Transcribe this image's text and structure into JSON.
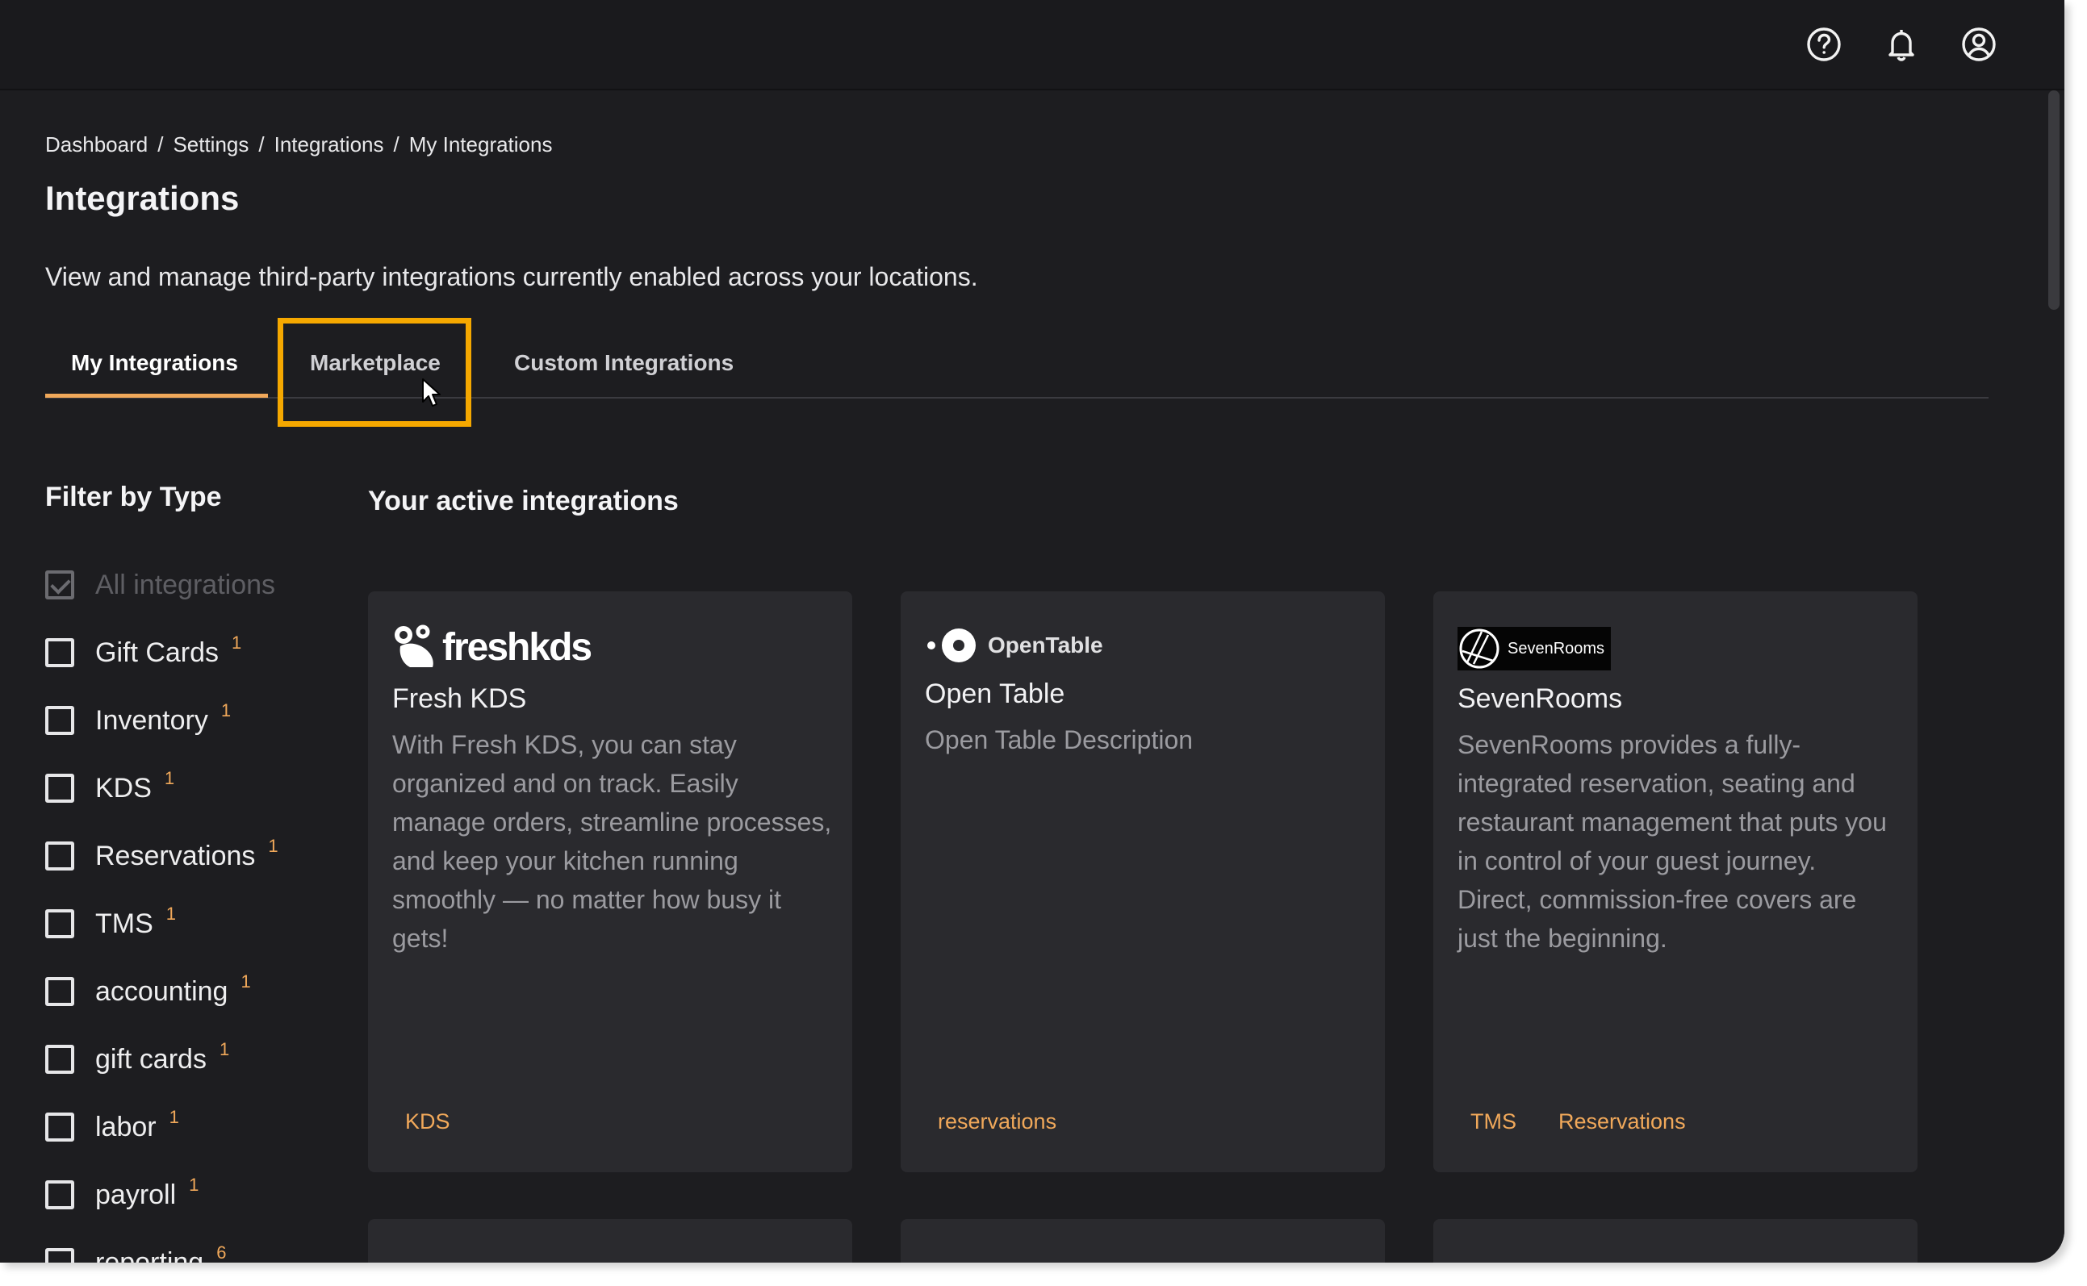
{
  "header": {
    "icons": [
      "help-circle-icon",
      "bell-icon",
      "user-circle-icon"
    ]
  },
  "breadcrumb": [
    "Dashboard",
    "Settings",
    "Integrations",
    "My Integrations"
  ],
  "page": {
    "title": "Integrations",
    "subtitle": "View and manage third-party integrations currently enabled across your locations."
  },
  "tabs": [
    {
      "label": "My Integrations",
      "active": true
    },
    {
      "label": "Marketplace",
      "active": false
    },
    {
      "label": "Custom Integrations",
      "active": false
    }
  ],
  "filter": {
    "title": "Filter by Type",
    "items": [
      {
        "label": "All integrations",
        "count": "",
        "checked": true
      },
      {
        "label": "Gift Cards",
        "count": "1",
        "checked": false
      },
      {
        "label": "Inventory",
        "count": "1",
        "checked": false
      },
      {
        "label": "KDS",
        "count": "1",
        "checked": false
      },
      {
        "label": "Reservations",
        "count": "1",
        "checked": false
      },
      {
        "label": "TMS",
        "count": "1",
        "checked": false
      },
      {
        "label": "accounting",
        "count": "1",
        "checked": false
      },
      {
        "label": "gift cards",
        "count": "1",
        "checked": false
      },
      {
        "label": "labor",
        "count": "1",
        "checked": false
      },
      {
        "label": "payroll",
        "count": "1",
        "checked": false
      },
      {
        "label": "reporting",
        "count": "6",
        "checked": false
      }
    ]
  },
  "main": {
    "section_title": "Your active integrations",
    "cards": [
      {
        "logo_text": "freshkds",
        "title": "Fresh KDS",
        "description": "With Fresh KDS, you can stay organized and on track. Easily manage orders, streamline processes, and keep your kitchen running smoothly — no matter how busy it gets!",
        "tags": [
          "KDS"
        ]
      },
      {
        "logo_text": "OpenTable",
        "title": "Open Table",
        "description": "Open Table Description",
        "tags": [
          "reservations"
        ]
      },
      {
        "logo_text": "SevenRooms",
        "title": "SevenRooms",
        "description": "SevenRooms provides a fully-integrated reservation, seating and restaurant management that puts you in control of your guest journey. Direct, commission-free covers are just the beginning.",
        "tags": [
          "TMS",
          "Reservations"
        ]
      }
    ]
  },
  "colors": {
    "accent": "#f0a85a",
    "highlight": "#f5a800",
    "background": "#1d1d20",
    "card": "#2a2a2e"
  }
}
